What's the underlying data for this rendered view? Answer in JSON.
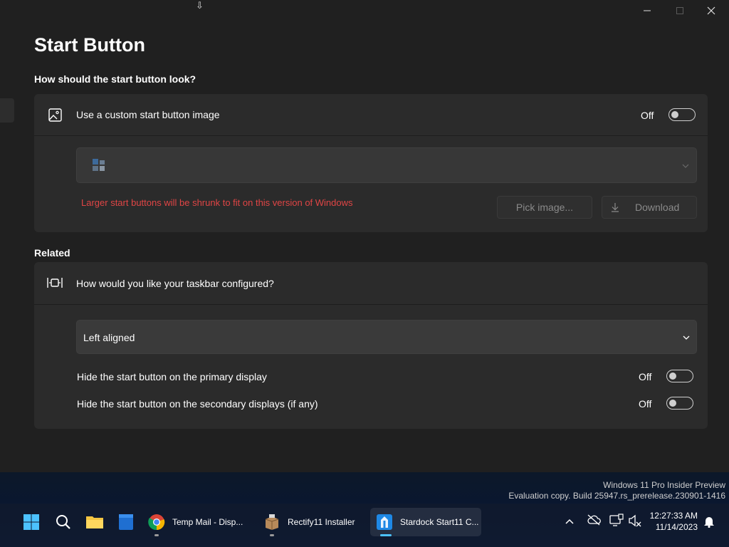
{
  "page": {
    "title": "Start Button",
    "section1_label": "How should the start button look?",
    "related_label": "Related"
  },
  "window_controls": {
    "minimize": "minimize",
    "maximize": "maximize",
    "close": "close"
  },
  "custom_image_card": {
    "label": "Use a custom start button image",
    "toggle_state": "Off",
    "warning": "Larger start buttons will be shrunk to fit on this version of Windows",
    "pick_image_label": "Pick image...",
    "download_label": "Download"
  },
  "taskbar_card": {
    "label": "How would you like your taskbar configured?",
    "alignment_value": "Left aligned",
    "hide_primary_label": "Hide the start button on the primary display",
    "hide_primary_state": "Off",
    "hide_secondary_label": "Hide the start button on the secondary displays (if any)",
    "hide_secondary_state": "Off"
  },
  "watermark": {
    "line1": "Windows 11 Pro Insider Preview",
    "line2": "Evaluation copy. Build 25947.rs_prerelease.230901-1416"
  },
  "taskbar": {
    "apps": [
      {
        "name": "start",
        "label": ""
      },
      {
        "name": "search",
        "label": ""
      },
      {
        "name": "file-explorer",
        "label": ""
      },
      {
        "name": "notepad",
        "label": ""
      },
      {
        "name": "chrome",
        "label": "Temp Mail - Disp..."
      },
      {
        "name": "rectify11",
        "label": "Rectify11 Installer"
      },
      {
        "name": "stardock",
        "label": "Stardock Start11 C..."
      }
    ],
    "time": "12:27:33 AM",
    "date": "11/14/2023"
  },
  "colors": {
    "background": "#202020",
    "card": "#2b2b2b",
    "warning": "#e04545",
    "accent": "#4cc2ff"
  }
}
